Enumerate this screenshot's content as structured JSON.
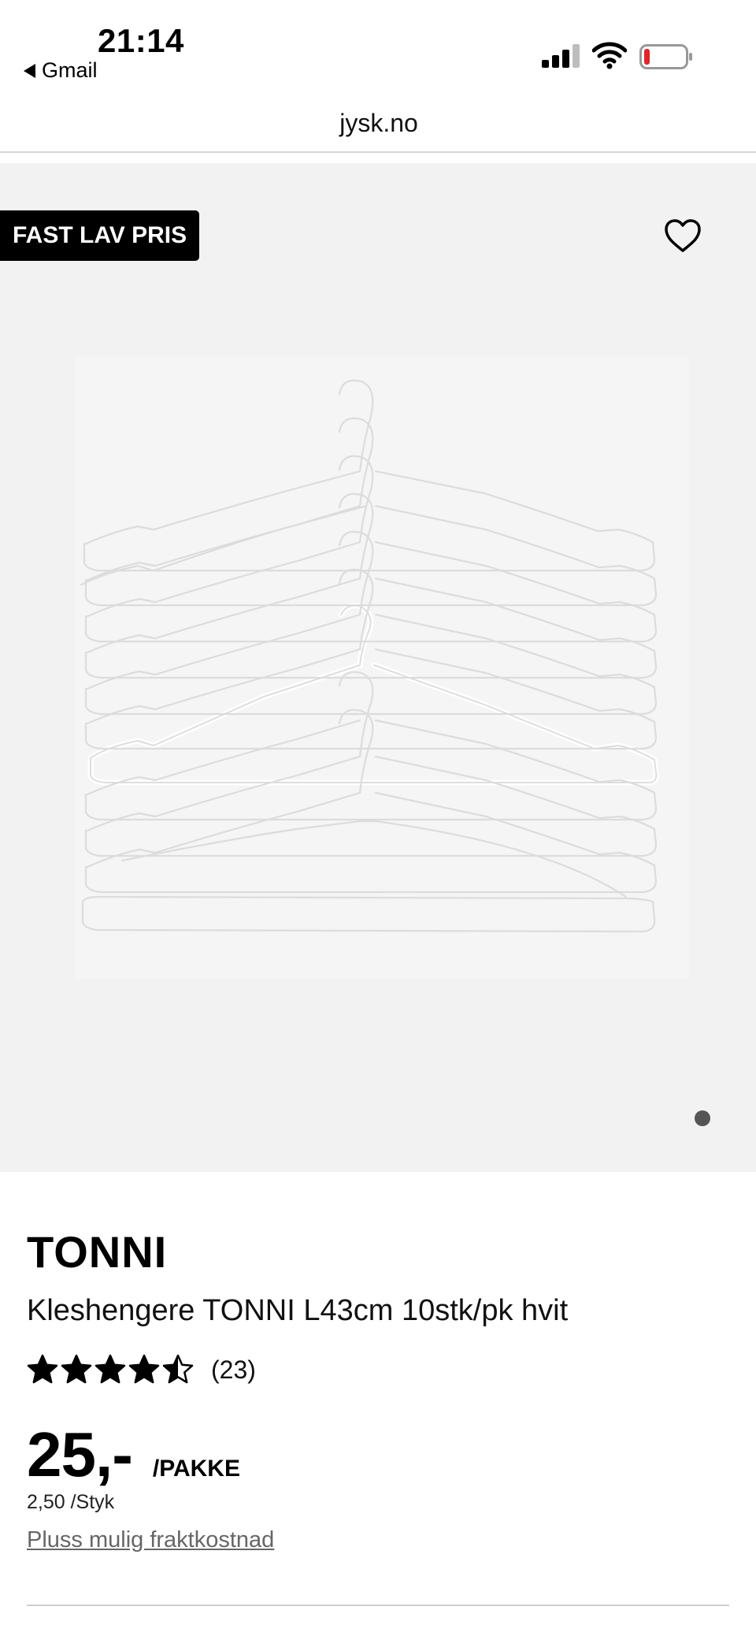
{
  "status_bar": {
    "time": "21:14",
    "back_label": "Gmail",
    "icons": [
      "signal-icon",
      "wifi-icon",
      "battery-icon"
    ]
  },
  "url_bar": {
    "domain": "jysk.no"
  },
  "gallery": {
    "badge": "FAST LAV PRIS",
    "wishlist_icon": "heart-icon",
    "image_alt": "hangers-image",
    "page_indicator_count": 1
  },
  "product": {
    "brand": "TONNI",
    "name": "Kleshengere TONNI L43cm 10stk/pk hvit",
    "rating": 4.5,
    "review_count": "(23)",
    "price": "25,-",
    "unit": "/PAKKE",
    "unit_price": "2,50 /Styk",
    "shipping_note": "Pluss mulig fraktkostnad"
  },
  "colors": {
    "badge_bg": "#000000",
    "gallery_bg": "#f2f2f2",
    "link_gray": "#666666"
  }
}
